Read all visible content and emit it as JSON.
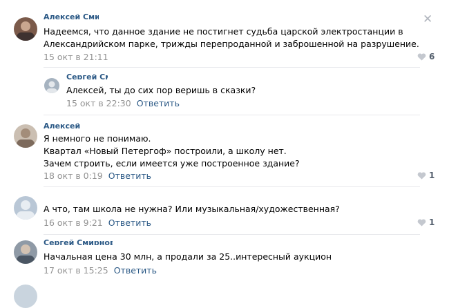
{
  "comments": [
    {
      "author": "Алексей Смит",
      "text": [
        "Надеемся, что данное здание не постигнет судьба царской электростанции в",
        "Александрийском парке, трижды перепроданной и заброшенной на разрушение."
      ],
      "date": "15 окт в 21:11",
      "likes": "6",
      "close": "✕"
    },
    {
      "author": "Сергей Смирнов",
      "text": [
        "Алексей, ты до сих пор веришь в сказки?"
      ],
      "date": "15 окт в 22:30",
      "reply": "Ответить"
    },
    {
      "author": "Алексей",
      "text": [
        "Я немного не понимаю.",
        "Квартал «Новый Петергоф» построили, а школу нет.",
        "Зачем строить, если имеется уже построенное здание?"
      ],
      "date": "18 окт в 0:19",
      "reply": "Ответить",
      "likes": "1"
    },
    {
      "text": [
        "А что, там школа не нужна? Или музыкальная/художественная?"
      ],
      "date": "16 окт в 9:21",
      "reply": "Ответить",
      "likes": "1"
    },
    {
      "author": "Сергей Смирнов",
      "text": [
        "Начальная цена 30 млн, а продали за 25..интересный аукцион"
      ],
      "date": "17 окт в 15:25",
      "reply": "Ответить"
    }
  ],
  "colors": {
    "link": "#2a5885",
    "meta": "#939393",
    "separator": "#e7e8ec"
  },
  "icons": {
    "like": "heart-icon",
    "close": "close-icon"
  }
}
